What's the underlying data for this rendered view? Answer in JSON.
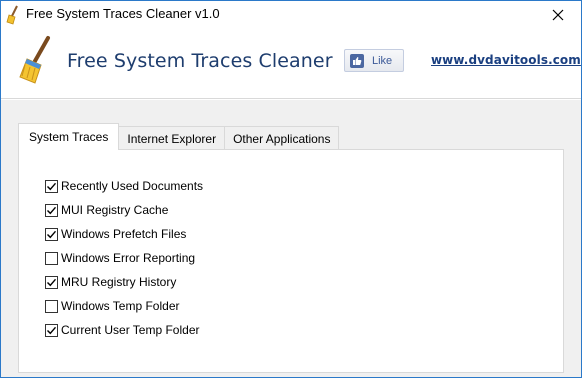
{
  "window": {
    "title": "Free System Traces Cleaner v1.0"
  },
  "header": {
    "app_name": "Free System Traces Cleaner",
    "like_label": "Like",
    "site_link": "www.dvdavitools.com"
  },
  "tabs": [
    {
      "label": "System Traces",
      "active": true
    },
    {
      "label": "Internet Explorer",
      "active": false
    },
    {
      "label": "Other Applications",
      "active": false
    }
  ],
  "options": [
    {
      "label": "Recently Used Documents",
      "checked": true
    },
    {
      "label": "MUI Registry Cache",
      "checked": true
    },
    {
      "label": "Windows Prefetch Files",
      "checked": true
    },
    {
      "label": "Windows Error Reporting",
      "checked": false
    },
    {
      "label": "MRU Registry History",
      "checked": true
    },
    {
      "label": "Windows Temp Folder",
      "checked": false
    },
    {
      "label": "Current User Temp Folder",
      "checked": true
    }
  ],
  "colors": {
    "title_text": "#1e3d6e",
    "link": "#1a3f80",
    "window_border": "#2b79c9",
    "panel_bg": "#f0f0f0"
  }
}
